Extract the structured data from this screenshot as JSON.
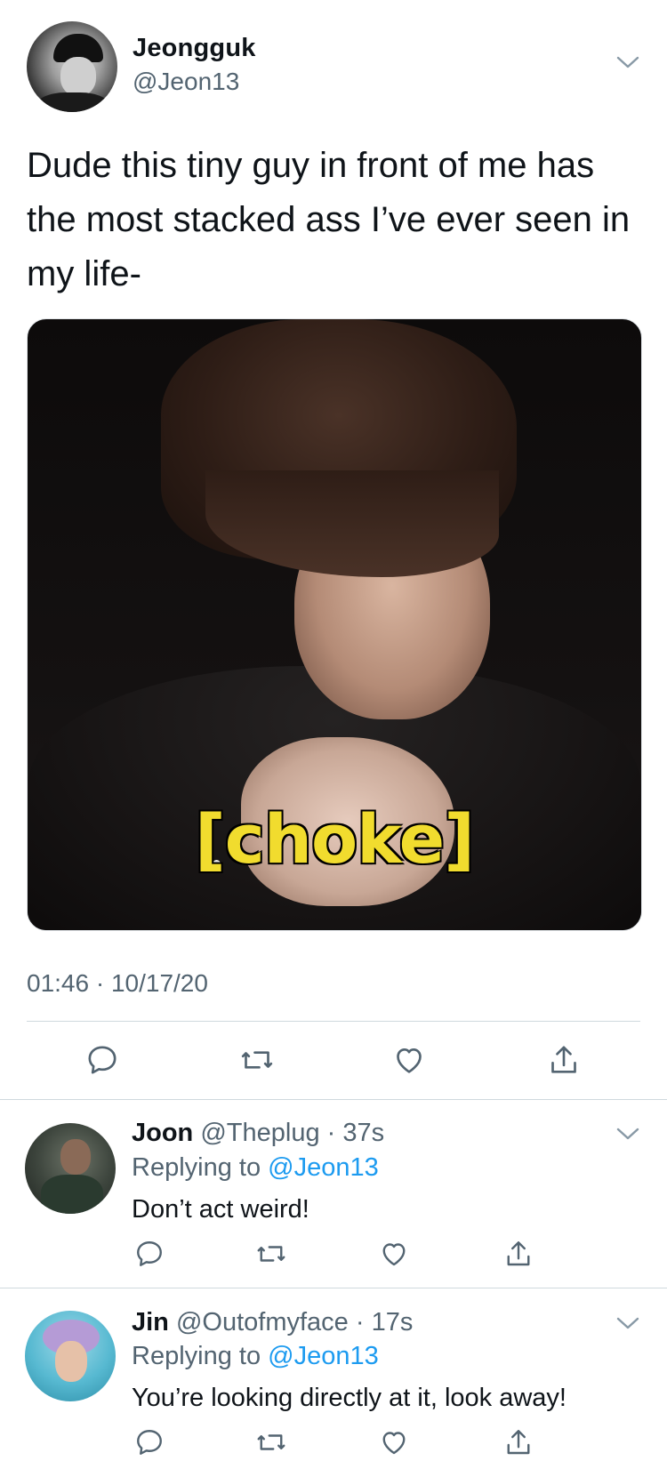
{
  "main_tweet": {
    "name": "Jeongguk",
    "handle": "@Jeon13",
    "text": "Dude this tiny guy in front of me has the most stacked ass I’ve ever seen in my life-",
    "media_caption": "[choke]",
    "timestamp": "01:46 · 10/17/20",
    "actions": [
      "reply-icon",
      "retweet-icon",
      "like-icon",
      "share-icon"
    ]
  },
  "replies": [
    {
      "name": "Joon",
      "meta": " @Theplug · 37s",
      "replying_label": "Replying to ",
      "replying_handle": "@Jeon13",
      "text": "Don’t act weird!"
    },
    {
      "name": "Jin",
      "meta": " @Outofmyface · 17s",
      "replying_label": "Replying to ",
      "replying_handle": "@Jeon13",
      "text": "You’re looking directly at it, look away!"
    }
  ],
  "colors": {
    "text": "#0f1419",
    "secondary": "#536471",
    "link": "#1d9bf0",
    "divider": "#cfd9de",
    "caption": "#f1dc2e"
  }
}
